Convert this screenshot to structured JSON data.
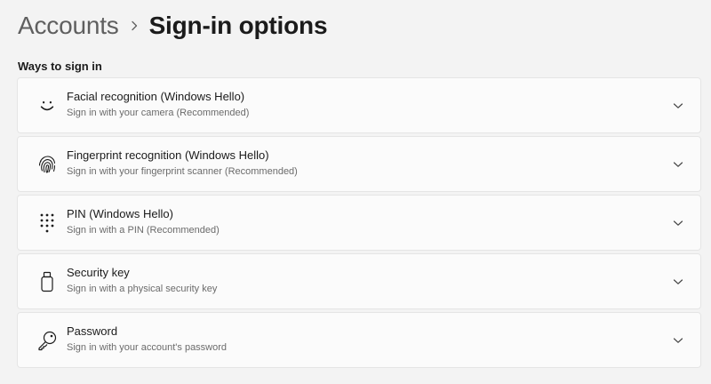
{
  "header": {
    "breadcrumb_parent": "Accounts",
    "breadcrumb_current": "Sign-in options",
    "separator_icon": "chevron-right-icon"
  },
  "section": {
    "title": "Ways to sign in"
  },
  "options": [
    {
      "title": "Facial recognition (Windows Hello)",
      "subtitle": "Sign in with your camera (Recommended)",
      "icon": "smiley-face-icon"
    },
    {
      "title": "Fingerprint recognition (Windows Hello)",
      "subtitle": "Sign in with your fingerprint scanner (Recommended)",
      "icon": "fingerprint-icon"
    },
    {
      "title": "PIN (Windows Hello)",
      "subtitle": "Sign in with a PIN (Recommended)",
      "icon": "keypad-icon"
    },
    {
      "title": "Security key",
      "subtitle": "Sign in with a physical security key",
      "icon": "usb-key-icon"
    },
    {
      "title": "Password",
      "subtitle": "Sign in with your account's password",
      "icon": "key-icon"
    }
  ],
  "colors": {
    "background": "#f3f3f3",
    "card": "#fbfbfb",
    "card_border": "#e5e5e5",
    "primary_text": "#1b1b1b",
    "secondary_text": "#6b6b6b",
    "breadcrumb_parent_text": "#5f5f5f"
  }
}
